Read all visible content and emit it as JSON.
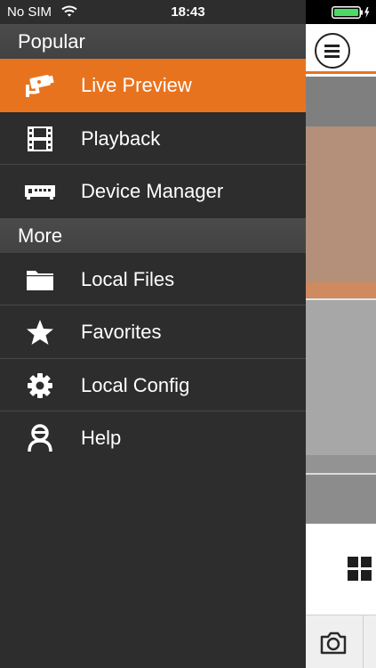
{
  "status_bar": {
    "carrier": "No SIM",
    "time": "18:43"
  },
  "drawer": {
    "sections": [
      {
        "header": "Popular",
        "items": [
          {
            "label": "Live Preview",
            "icon": "cctv-camera-icon",
            "active": true
          },
          {
            "label": "Playback",
            "icon": "film-strip-icon",
            "active": false
          },
          {
            "label": "Device Manager",
            "icon": "dvr-device-icon",
            "active": false
          }
        ]
      },
      {
        "header": "More",
        "items": [
          {
            "label": "Local Files",
            "icon": "folder-icon",
            "active": false
          },
          {
            "label": "Favorites",
            "icon": "star-icon",
            "active": false
          },
          {
            "label": "Local Config",
            "icon": "gear-icon",
            "active": false
          },
          {
            "label": "Help",
            "icon": "help-person-icon",
            "active": false
          }
        ]
      }
    ]
  },
  "colors": {
    "accent": "#e8731f",
    "drawer_bg": "#2d2d2d",
    "section_header_bg": "#464646",
    "divider": "#484848",
    "battery": "#4cd964"
  }
}
